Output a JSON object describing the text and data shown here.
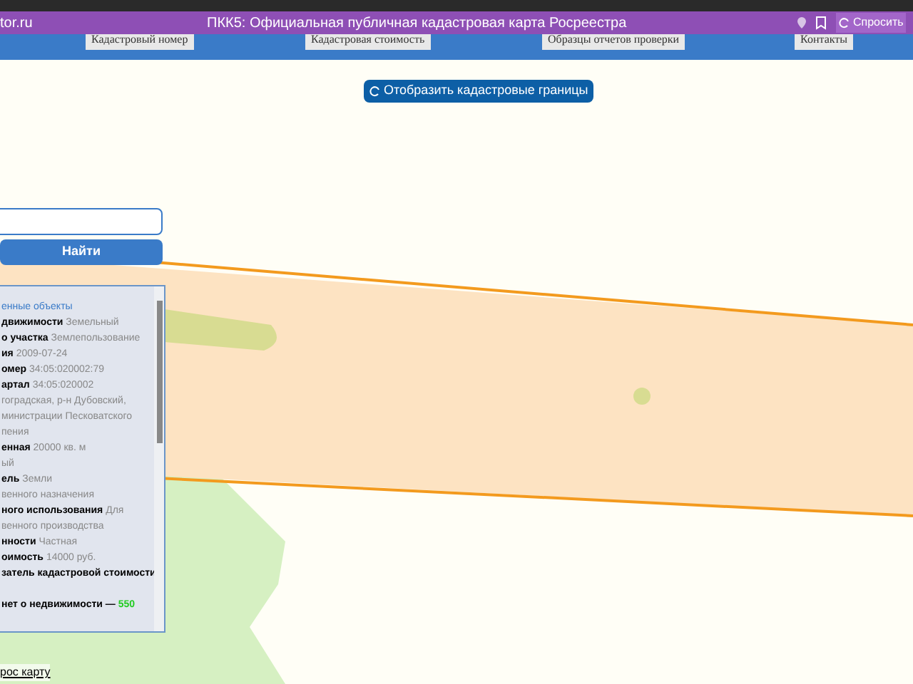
{
  "browser_bar": {
    "site": "tor.ru",
    "title": "ПКК5: Официальная публичная кадастровая карта Росреестра",
    "ask_button": "Спросить"
  },
  "nav": [
    "Кадастровый номер",
    "Кадастровая стоимость",
    "Образцы отчетов проверки",
    "Контакты"
  ],
  "show_borders_button": "Отобразить кадастровые границы",
  "search": {
    "button": "Найти"
  },
  "info_lines": [
    {
      "kind": "link",
      "value": "енные объекты"
    },
    {
      "kind": "field",
      "label": "движимости",
      "value": "Земельный"
    },
    {
      "kind": "field",
      "label": "о участка",
      "value": "Землепользование"
    },
    {
      "kind": "field",
      "label": "ия",
      "value": "2009-07-24"
    },
    {
      "kind": "field",
      "label": "омер",
      "value": "34:05:020002:79"
    },
    {
      "kind": "field",
      "label": "артал",
      "value": "34:05:020002"
    },
    {
      "kind": "field",
      "value": "гоградская, р-н Дубовский,"
    },
    {
      "kind": "field",
      "value": "министрации Песковатского"
    },
    {
      "kind": "field",
      "value": "пения"
    },
    {
      "kind": "field",
      "label": "енная",
      "value": "20000 кв. м"
    },
    {
      "kind": "field",
      "value": "ый"
    },
    {
      "kind": "field",
      "label": "ель",
      "value": "Земли"
    },
    {
      "kind": "field",
      "value": "венного назначения"
    },
    {
      "kind": "field",
      "label": "ного использования",
      "value": "Для"
    },
    {
      "kind": "field",
      "value": "венного производства"
    },
    {
      "kind": "field",
      "label": "нности",
      "value": "Частная"
    },
    {
      "kind": "field",
      "label": "оимость",
      "value": "14000 руб."
    },
    {
      "kind": "field",
      "label": "затель кадастровой стоимости"
    },
    {
      "kind": "gap"
    },
    {
      "kind": "highlight",
      "label": "нет о недвижимости —",
      "value": "550"
    }
  ],
  "bottom_link": "рос карту"
}
